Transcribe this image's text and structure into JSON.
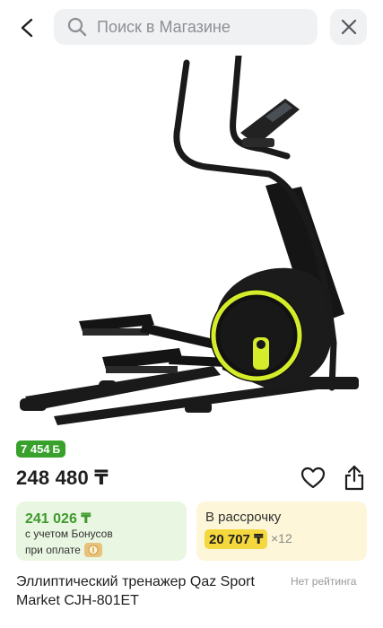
{
  "search": {
    "placeholder": "Поиск в Магазине"
  },
  "icons": {
    "back": "back-arrow-icon",
    "search": "search-icon",
    "close": "close-icon",
    "favorite": "heart-icon",
    "share": "share-icon",
    "bonus_coin": "bonus-coin-icon"
  },
  "product": {
    "bonus_badge": "7 454",
    "bonus_badge_unit": "Б",
    "price": "248 480 ₸",
    "title": "Эллиптический тренажер Qaz Sport Market CJH-801ET",
    "rating": "Нет рейтинга"
  },
  "bonus_card": {
    "amount": "241 026 ₸",
    "line1": "с учетом Бонусов",
    "line2": "при оплате"
  },
  "credit_card": {
    "title": "В рассрочку",
    "monthly": "20 707 ₸",
    "months": "×12"
  },
  "colors": {
    "bonus_green": "#38a12b",
    "bonus_card_bg": "#e9f6e1",
    "credit_card_bg": "#fdf6d8",
    "monthly_highlight": "#f5d83e",
    "accent_yellow_green": "#d4ec2a"
  }
}
